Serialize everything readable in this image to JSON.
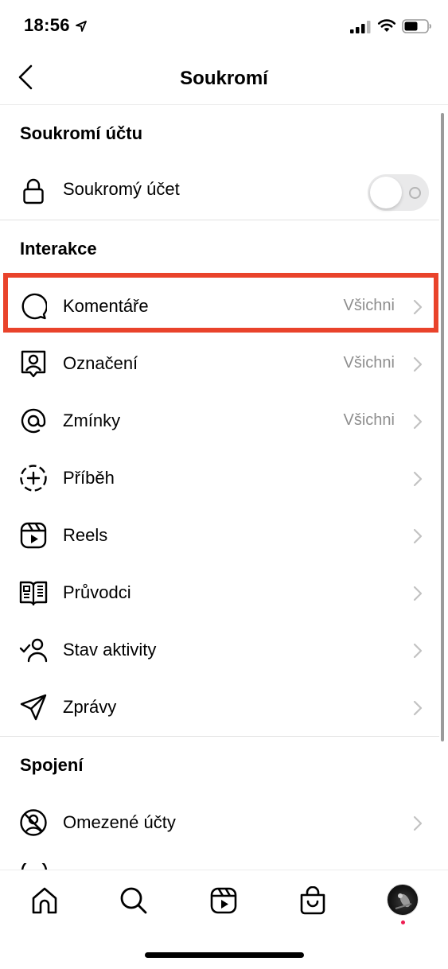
{
  "status_bar": {
    "time": "18:56"
  },
  "nav": {
    "title": "Soukromí"
  },
  "sections": {
    "account_privacy": {
      "title": "Soukromí účtu",
      "private_account": {
        "label": "Soukromý účet",
        "toggle_on": false
      }
    },
    "interactions": {
      "title": "Interakce",
      "items": [
        {
          "label": "Komentáře",
          "value": "Všichni",
          "icon": "comment-icon"
        },
        {
          "label": "Označení",
          "value": "Všichni",
          "icon": "tag-person-icon"
        },
        {
          "label": "Zmínky",
          "value": "Všichni",
          "icon": "at-sign-icon"
        },
        {
          "label": "Příběh",
          "value": "",
          "icon": "story-add-icon"
        },
        {
          "label": "Reels",
          "value": "",
          "icon": "reels-icon"
        },
        {
          "label": "Průvodci",
          "value": "",
          "icon": "guides-icon"
        },
        {
          "label": "Stav aktivity",
          "value": "",
          "icon": "activity-status-icon"
        },
        {
          "label": "Zprávy",
          "value": "",
          "icon": "paper-plane-icon"
        }
      ]
    },
    "connections": {
      "title": "Spojení",
      "items": [
        {
          "label": "Omezené účty",
          "value": "",
          "icon": "restricted-accounts-icon"
        }
      ]
    }
  },
  "tab_bar": {
    "items": [
      "home-icon",
      "search-icon",
      "reels-icon",
      "shop-icon",
      "profile-avatar"
    ]
  },
  "colors": {
    "highlight": "#e9432b",
    "secondary_text": "#8e8e8e",
    "notification_dot": "#ee1d52"
  }
}
